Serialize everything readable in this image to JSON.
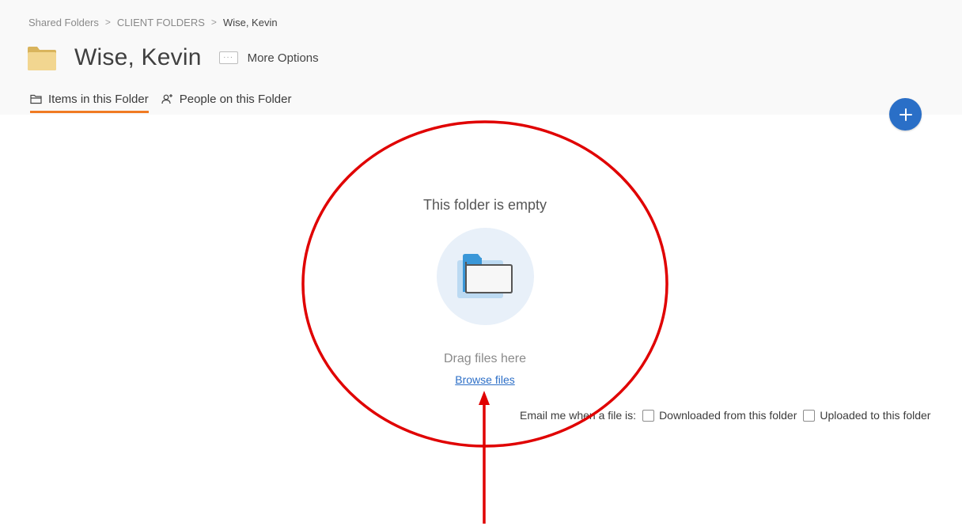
{
  "breadcrumb": {
    "items": [
      "Shared Folders",
      "CLIENT FOLDERS"
    ],
    "current": "Wise, Kevin",
    "separator": ">"
  },
  "header": {
    "title": "Wise, Kevin",
    "folder_icon": "folder-icon",
    "more_options_label": "More Options"
  },
  "tabs": [
    {
      "label": "Items in this Folder",
      "icon": "folder-outline-icon",
      "active": true
    },
    {
      "label": "People on this Folder",
      "icon": "person-add-icon",
      "active": false
    }
  ],
  "add_button": {
    "icon": "plus-icon"
  },
  "empty_state": {
    "title": "This folder is empty",
    "drag_text": "Drag files here",
    "browse_label": "Browse files"
  },
  "notifications": {
    "prefix": "Email me when a file is:",
    "options": [
      {
        "label": "Downloaded from this folder",
        "checked": false
      },
      {
        "label": "Uploaded to this folder",
        "checked": false
      }
    ]
  },
  "colors": {
    "accent_orange": "#f07b23",
    "primary_blue": "#2a6fc7",
    "annotation_red": "#e00000"
  }
}
